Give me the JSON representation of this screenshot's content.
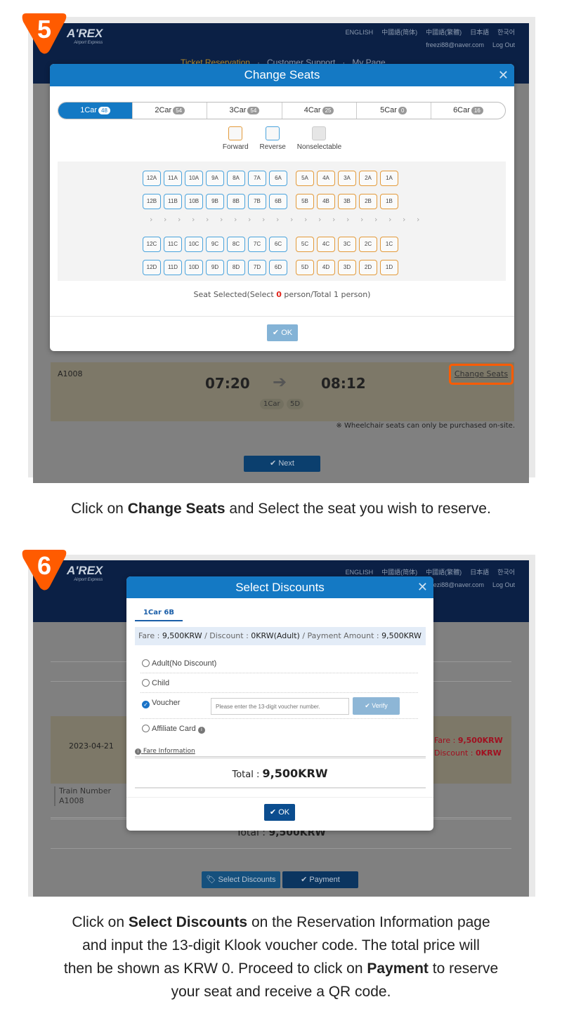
{
  "colors": {
    "accent": "#ff5b00",
    "modal_header": "#1479c4",
    "header_bg": "#0b2045",
    "forward": "#e39a3a",
    "reverse": "#4aa3dc",
    "fare_red": "#c3122a"
  },
  "site": {
    "logo": "A'REX",
    "logo_sub": "Airport Express",
    "languages": [
      "ENGLISH",
      "中國語(简体)",
      "中國語(繁體)",
      "日本語",
      "한국어"
    ],
    "user_email": "freezi88@naver.com",
    "logout": "Log Out",
    "nav": [
      "Ticket Reservation",
      "Customer Support",
      "My Page"
    ]
  },
  "step5": {
    "badge": "5",
    "modal": {
      "title": "Change Seats",
      "tabs": [
        {
          "label": "1Car",
          "count": "48",
          "active": true
        },
        {
          "label": "2Car",
          "count": "54"
        },
        {
          "label": "3Car",
          "count": "54"
        },
        {
          "label": "4Car",
          "count": "25"
        },
        {
          "label": "5Car",
          "count": "0"
        },
        {
          "label": "6Car",
          "count": "16"
        }
      ],
      "legend": [
        "Forward",
        "Reverse",
        "Nonselectable"
      ],
      "seat_rows": [
        [
          "12A",
          "11A",
          "10A",
          "9A",
          "8A",
          "7A",
          "6A",
          "5A",
          "4A",
          "3A",
          "2A",
          "1A"
        ],
        [
          "12B",
          "11B",
          "10B",
          "9B",
          "8B",
          "7B",
          "6B",
          "5B",
          "4B",
          "3B",
          "2B",
          "1B"
        ],
        [
          "12C",
          "11C",
          "10C",
          "9C",
          "8C",
          "7C",
          "6C",
          "5C",
          "4C",
          "3C",
          "2C",
          "1C"
        ],
        [
          "12D",
          "11D",
          "10D",
          "9D",
          "8D",
          "7D",
          "6D",
          "5D",
          "4D",
          "3D",
          "2D",
          "1D"
        ]
      ],
      "reverse_seats_per_row": 7,
      "status_pre": "Seat Selected(Select ",
      "status_count": "0",
      "status_post": " person/Total 1 person)",
      "ok": "OK"
    },
    "train": "A1008",
    "depart": "07:20",
    "arrive": "08:12",
    "car": "1Car",
    "seat": "5D",
    "change_seats": "Change Seats",
    "note": "※ Wheelchair seats can only be purchased on-site.",
    "next": "Next",
    "caption_pre": "Click on ",
    "caption_bold": "Change Seats",
    "caption_post": " and Select the seat you wish to reserve."
  },
  "step6": {
    "badge": "6",
    "modal": {
      "title": "Select Discounts",
      "tab": "1Car 6B",
      "fare_label": "Fare",
      "fare": "9,500KRW",
      "discount_label": "Discount",
      "discount": "0KRW(Adult)",
      "payment_label": "Payment Amount",
      "payment": "9,500KRW",
      "options": [
        {
          "label": "Adult(No Discount)",
          "checked": false
        },
        {
          "label": "Child",
          "checked": false
        },
        {
          "label": "Voucher",
          "checked": true
        },
        {
          "label": "Affiliate Card",
          "checked": false
        }
      ],
      "voucher_placeholder": "Please enter the 13-digit voucher number.",
      "verify": "Verify",
      "fare_info": "Fare Information",
      "total_label": "Total :",
      "total": "9,500KRW",
      "ok": "OK"
    },
    "date": "2023-04-21",
    "train_label": "Train Number",
    "train": "A1008",
    "side_fare_label": "Fare :",
    "side_fare": "9,500KRW",
    "side_discount_label": "Discount :",
    "side_discount": "0KRW",
    "bg_total_label": "Total :",
    "bg_total": "9,500KRW",
    "select_discounts": "Select Discounts",
    "payment": "Payment",
    "caption": [
      "Click on ",
      "Select Discounts",
      " on the Reservation Information page",
      "and input the 13-digit Klook voucher code. The total price will",
      "then be shown as KRW 0. Proceed to click on ",
      "Payment",
      " to reserve",
      "your seat and receive a QR code."
    ]
  }
}
